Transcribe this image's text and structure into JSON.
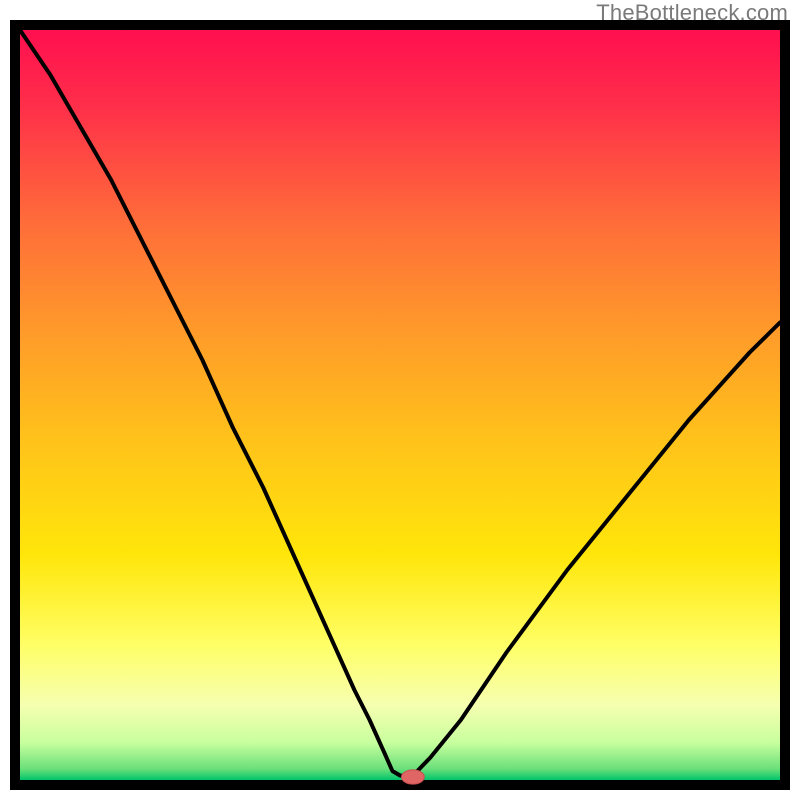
{
  "watermark": "TheBottleneck.com",
  "colors": {
    "border": "#000000",
    "curve": "#000000",
    "marker_fill": "#e06666",
    "marker_stroke": "#c94f4f",
    "gradient": {
      "stops": [
        {
          "offset": 0.0,
          "color": "#ff0f4f"
        },
        {
          "offset": 0.1,
          "color": "#ff2e4a"
        },
        {
          "offset": 0.25,
          "color": "#ff6a3a"
        },
        {
          "offset": 0.4,
          "color": "#ff9a2a"
        },
        {
          "offset": 0.55,
          "color": "#ffc31a"
        },
        {
          "offset": 0.7,
          "color": "#ffe60a"
        },
        {
          "offset": 0.82,
          "color": "#ffff66"
        },
        {
          "offset": 0.9,
          "color": "#f6ffb0"
        },
        {
          "offset": 0.95,
          "color": "#c8ff9e"
        },
        {
          "offset": 0.985,
          "color": "#6be07a"
        },
        {
          "offset": 1.0,
          "color": "#00c46a"
        }
      ]
    }
  },
  "chart_data": {
    "type": "line",
    "title": "",
    "xlabel": "",
    "ylabel": "",
    "xlim": [
      0,
      100
    ],
    "ylim": [
      0,
      100
    ],
    "series": [
      {
        "name": "bottleneck-curve",
        "x": [
          0,
          4,
          8,
          12,
          16,
          20,
          24,
          28,
          32,
          36,
          40,
          44,
          46,
          48,
          49,
          50,
          51,
          52,
          54,
          58,
          64,
          72,
          80,
          88,
          96,
          100
        ],
        "y": [
          100,
          94,
          87,
          80,
          72,
          64,
          56,
          47,
          39,
          30,
          21,
          12,
          8,
          3.5,
          1.2,
          0.6,
          0.5,
          0.9,
          3,
          8,
          17,
          28,
          38,
          48,
          57,
          61
        ]
      }
    ],
    "marker": {
      "x": 51.7,
      "y": 0.4,
      "rx": 1.5,
      "ry": 0.95
    }
  }
}
